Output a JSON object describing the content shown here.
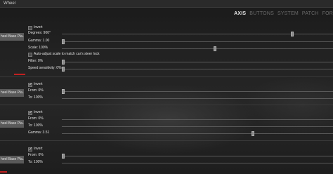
{
  "window": {
    "title": "Wheel"
  },
  "tabs": [
    {
      "label": "AXIS",
      "active": true
    },
    {
      "label": "BUTTONS",
      "active": false
    },
    {
      "label": "SYSTEM",
      "active": false
    },
    {
      "label": "PATCH",
      "active": false
    },
    {
      "label": "FOR",
      "active": false
    }
  ],
  "sections": [
    {
      "button_label": "heel Base Pla...",
      "invert": {
        "label": "Invert",
        "checked": false
      },
      "degrees": {
        "label": "Degrees: 900°",
        "value": 0.85
      },
      "gamma": {
        "label": "Gamma: 1.00",
        "value": 0.0
      },
      "scale": {
        "label": "Scale: 100%",
        "value": 0.57
      },
      "auto_adjust": {
        "label": "Auto-adjust scale to match car's steer lock",
        "checked": false
      },
      "filter": {
        "label": "Filter: 0%",
        "value": 0.0
      },
      "speed": {
        "label": "Speed sensitivity: 0%",
        "value": 0.0
      }
    },
    {
      "button_label": "heel Base Pla...",
      "invert": {
        "label": "Invert",
        "checked": true
      },
      "from": {
        "label": "From: 0%",
        "value": 0.0
      },
      "to": {
        "label": "To: 100%"
      }
    },
    {
      "button_label": "heel Base Pla...",
      "invert": {
        "label": "Invert",
        "checked": true
      },
      "from": {
        "label": "From: 0%"
      },
      "to": {
        "label": "To: 100%"
      },
      "gamma": {
        "label": "Gamma: 3.51",
        "value": 0.7
      }
    },
    {
      "button_label": "heel Base Pla...",
      "invert": {
        "label": "Invert",
        "checked": true
      },
      "from": {
        "label": "From: 0%",
        "value": 0.0
      },
      "to": {
        "label": "To: 100%"
      }
    }
  ]
}
